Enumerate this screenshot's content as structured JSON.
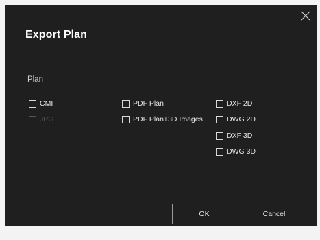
{
  "dialog": {
    "title": "Export Plan",
    "close_icon": "close-icon"
  },
  "plan_section": {
    "label": "Plan",
    "options": {
      "cmi": {
        "label": "CMI",
        "checked": false,
        "enabled": true
      },
      "jpg": {
        "label": "JPG",
        "checked": false,
        "enabled": false
      },
      "pdf_plan": {
        "label": "PDF Plan",
        "checked": false,
        "enabled": true
      },
      "pdf_plan_3d": {
        "label": "PDF Plan+3D Images",
        "checked": false,
        "enabled": true
      },
      "dxf_2d": {
        "label": "DXF 2D",
        "checked": false,
        "enabled": true
      },
      "dwg_2d": {
        "label": "DWG 2D",
        "checked": false,
        "enabled": true
      },
      "dxf_3d": {
        "label": "DXF 3D",
        "checked": false,
        "enabled": true
      },
      "dwg_3d": {
        "label": "DWG 3D",
        "checked": false,
        "enabled": true
      }
    }
  },
  "buttons": {
    "ok": "OK",
    "cancel": "Cancel"
  },
  "colors": {
    "dialog_background": "#1f1f1f",
    "page_background": "#f3f3f3",
    "text": "#e6e6e6",
    "disabled_text": "#555555",
    "button_border": "#9a9a9a"
  }
}
